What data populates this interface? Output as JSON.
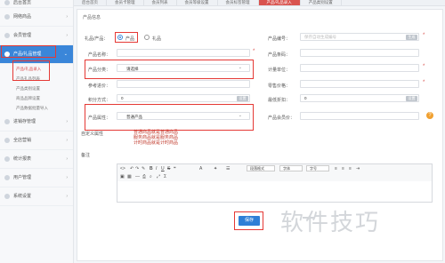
{
  "sidebar": {
    "top_item": "后台首页",
    "items": [
      {
        "label": "网络商品"
      },
      {
        "label": "会员管理"
      },
      {
        "label": "产品/礼品管理"
      },
      {
        "label": "进销存管理"
      },
      {
        "label": "全店营销"
      },
      {
        "label": "统计报表"
      },
      {
        "label": "用户管理"
      },
      {
        "label": "系统设置"
      }
    ],
    "sub_items": [
      {
        "label": "产品/礼品录入"
      },
      {
        "label": "产品礼品列表"
      },
      {
        "label": "产品类别设置"
      },
      {
        "label": "商品品牌设置"
      },
      {
        "label": "产品数据批量导入"
      }
    ]
  },
  "tabs": [
    {
      "label": "后台首页"
    },
    {
      "label": "会员卡管理"
    },
    {
      "label": "会员列表"
    },
    {
      "label": "会员等级设置"
    },
    {
      "label": "会员标签管理"
    },
    {
      "label": "产品/礼品录入"
    },
    {
      "label": "产品类别设置"
    }
  ],
  "form": {
    "section_title": "产品信息",
    "type_label": "礼品/产品：",
    "type_product": "产品",
    "type_gift": "礼品",
    "name_label": "产品名称：",
    "code_label": "产品编号：",
    "code_placeholder": "保存自动生成编号",
    "code_btn": "生成",
    "barcode_label": "产品条码：",
    "category_label": "产品分类：",
    "category_value": "请选择",
    "unit_label": "计量单位：",
    "ref_price_label": "参考进价：",
    "retail_label": "零售价格：",
    "points_label": "积分方式：",
    "points_value": "0",
    "points_btn": "设置",
    "min_discount_label": "最低折扣：",
    "min_discount_value": "0",
    "min_discount_btn": "设置",
    "attr_label": "产品属性：",
    "attr_value": "普通产品",
    "member_price_label": "产品会员价：",
    "custom_attr_label": "自定义属性",
    "remark_label": "备注",
    "save_label": "保存"
  },
  "preview_lines": [
    "普通商品就是普通商品",
    "服务商品就是服务商品",
    "计时商品就是计时商品"
  ],
  "editor_toolbar": {
    "format": "段落格式",
    "font": "字体",
    "size": "字号"
  },
  "watermark": "软件技巧",
  "colors": {
    "accent": "#3a86d9",
    "active_tab": "#d9534f",
    "highlight": "#e53935"
  }
}
